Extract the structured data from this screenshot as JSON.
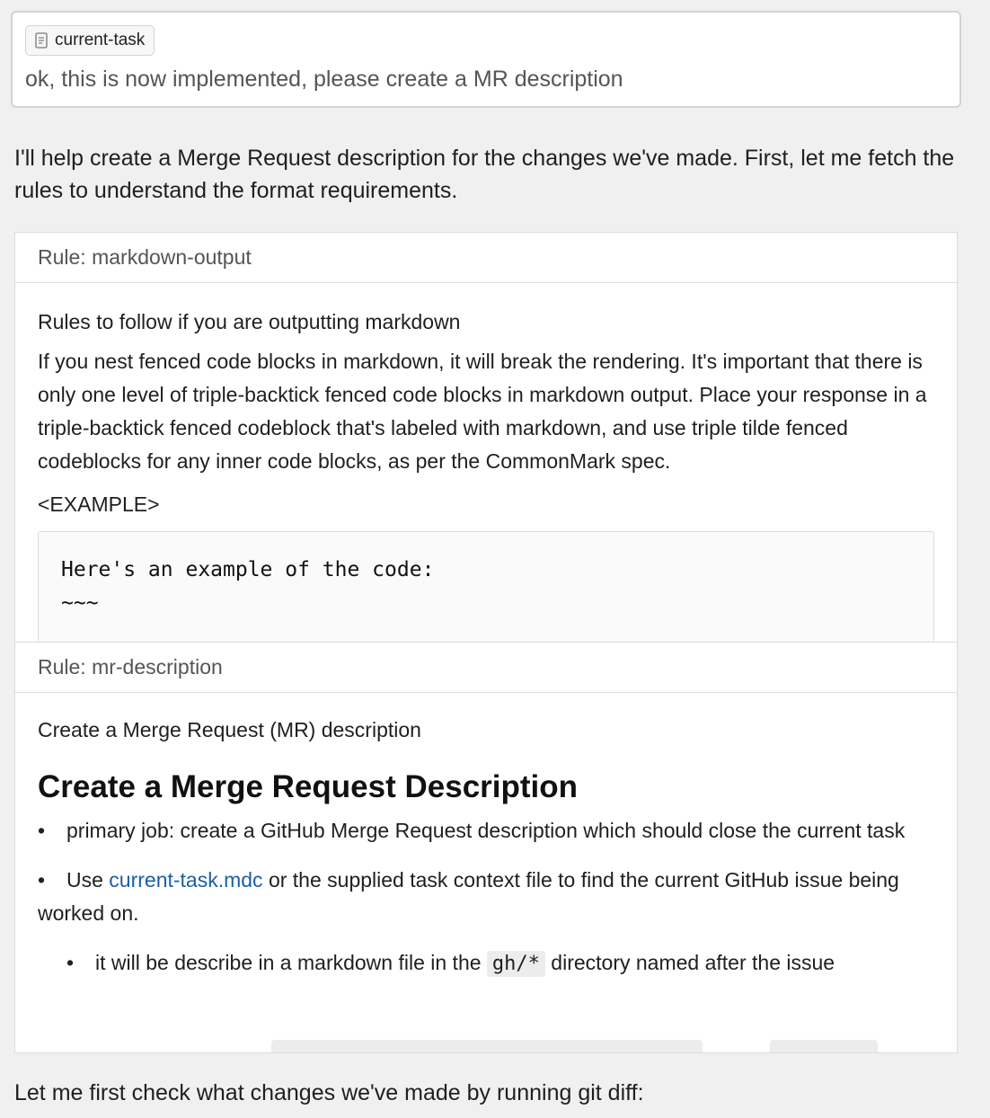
{
  "user_message": {
    "context_chip": {
      "label": "current-task",
      "icon": "file-icon"
    },
    "text": "ok, this is now implemented, please create a MR description"
  },
  "assistant": {
    "intro": "I'll help create a Merge Request description for the changes we've made. First, let me fetch the rules to understand the format requirements.",
    "outro": "Let me first check what changes we've made by running git diff:"
  },
  "rules": [
    {
      "header": "Rule: markdown-output",
      "subtitle": "Rules to follow if you are outputting markdown",
      "paragraph": "If you nest fenced code blocks in markdown, it will break the rendering. It's important that there is only one level of triple-backtick fenced code blocks in markdown output. Place your response in a triple-backtick fenced codeblock that's labeled with markdown, and use triple tilde fenced codeblocks for any inner code blocks, as per the CommonMark spec.",
      "example_tag": "<EXAMPLE>",
      "code_lines": [
        "Here's an example of the code:",
        "~~~"
      ]
    },
    {
      "header": "Rule: mr-description",
      "subtitle": "Create a Merge Request (MR) description",
      "heading": "Create a Merge Request Description",
      "bullets": [
        {
          "text": "primary job: create a GitHub Merge Request description which should close the current task"
        },
        {
          "prefix": "Use ",
          "link": "current-task.mdc",
          "suffix": " or the supplied task context file to find the current GitHub issue being worked on."
        }
      ],
      "nested_bullet": {
        "prefix": "it will be describe in a markdown file in the ",
        "code": "gh/*",
        "suffix": " directory named after the issue"
      }
    }
  ]
}
